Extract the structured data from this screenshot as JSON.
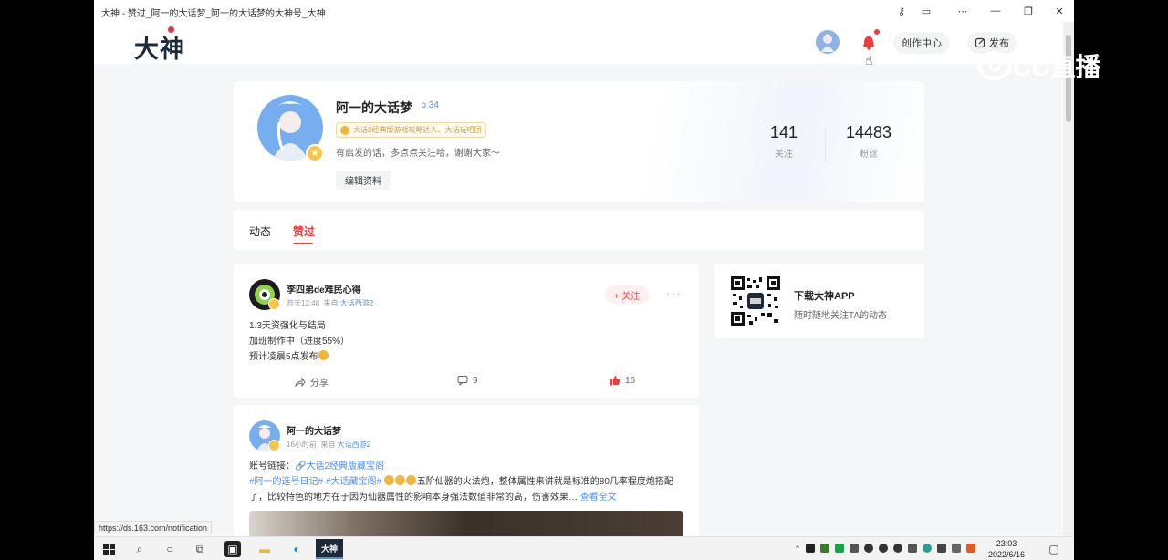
{
  "window": {
    "title": "大神 - 赞过_阿一的大话梦_阿一的大话梦的大神号_大神"
  },
  "topnav": {
    "logo": "大神",
    "creator_label": "创作中心",
    "publish_label": "发布",
    "live_brand": "CC直播"
  },
  "profile": {
    "name": "阿一的大话梦",
    "level": "34",
    "tag": "大话2经典版游戏攻略达人、大话玩吧团",
    "bio": "有启发的话，多点点关注哈，谢谢大家～",
    "edit_label": "编辑资料",
    "stats": [
      {
        "value": "141",
        "label": "关注"
      },
      {
        "value": "14483",
        "label": "粉丝"
      }
    ]
  },
  "tabs": [
    {
      "label": "动态",
      "active": false
    },
    {
      "label": "赞过",
      "active": true
    }
  ],
  "posts": [
    {
      "author": "李四弟de难民心得",
      "time": "昨天12:48",
      "from_prefix": "来自",
      "game": "大话西游2",
      "follow_label": "+ 关注",
      "lines": [
        "1.3天资强化与结局",
        "加班制作中（进度55%）",
        "预计凌晨5点发布"
      ],
      "share_label": "分享",
      "comments": "9",
      "likes": "16"
    },
    {
      "author": "阿一的大话梦",
      "time": "16小时前",
      "from_prefix": "来自",
      "game": "大话西游2",
      "account_prefix": "账号链接：",
      "account_link": "大话2经典版藏宝阁",
      "tags": "#阿一的选号日记# #大话藏宝阁#",
      "body": "五阶仙器的火法炮，整体属性来讲就是标准的80几率程度炮搭配了，比较特色的地方在于因为仙器属性的影响本身强法数值非常的高，伤害效果…",
      "read_more": "查看全文"
    }
  ],
  "sidebar": {
    "download_title": "下载大神APP",
    "download_sub": "随时随地关注TA的动态"
  },
  "statusbar": {
    "url": "https://ds.163.com/notification"
  },
  "taskbar": {
    "active_app": "大神",
    "time": "23:03",
    "date": "2022/6/16"
  },
  "colors": {
    "accent_red": "#f23c3c",
    "link_blue": "#4a8df0"
  }
}
